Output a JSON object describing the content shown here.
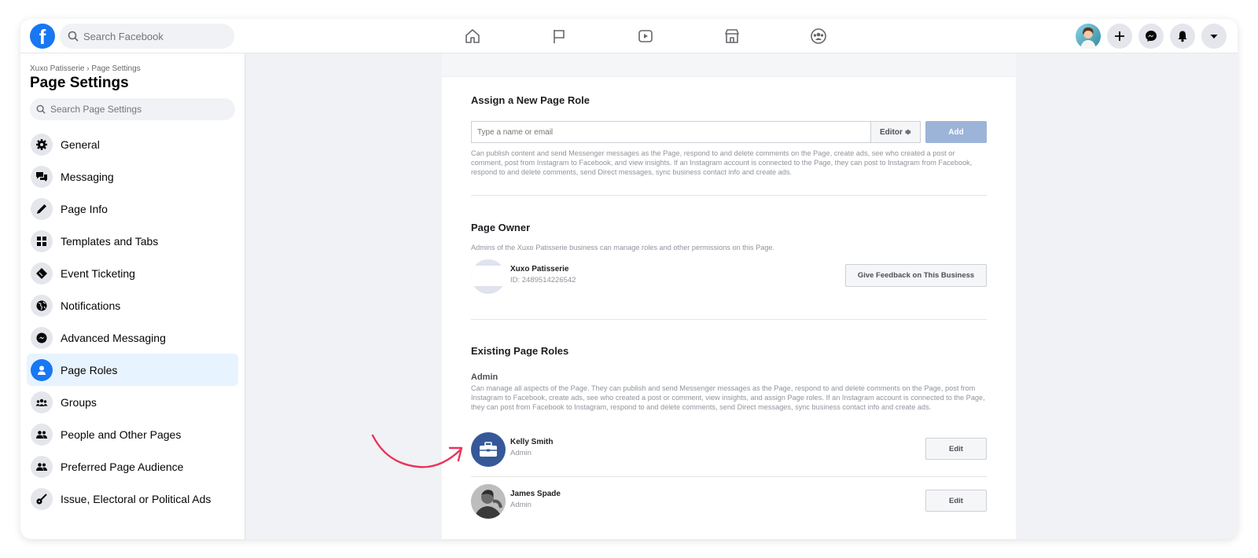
{
  "topbar": {
    "logo_letter": "f",
    "search_placeholder": "Search Facebook",
    "nav_icons": [
      "home-icon",
      "flag-icon",
      "video-icon",
      "marketplace-icon",
      "groups-icon"
    ],
    "right_icons": [
      "avatar",
      "plus-icon",
      "messenger-icon",
      "bell-icon",
      "caret-down-icon"
    ]
  },
  "sidebar": {
    "breadcrumb": "Xuxo Patisserie › Page Settings",
    "title": "Page Settings",
    "search_placeholder": "Search Page Settings",
    "items": [
      {
        "label": "General",
        "icon": "gear-icon"
      },
      {
        "label": "Messaging",
        "icon": "chat-icon"
      },
      {
        "label": "Page Info",
        "icon": "pencil-icon"
      },
      {
        "label": "Templates and Tabs",
        "icon": "grid-icon"
      },
      {
        "label": "Event Ticketing",
        "icon": "ticket-icon"
      },
      {
        "label": "Notifications",
        "icon": "globe-icon"
      },
      {
        "label": "Advanced Messaging",
        "icon": "messenger-icon"
      },
      {
        "label": "Page Roles",
        "icon": "person-icon",
        "active": true
      },
      {
        "label": "Groups",
        "icon": "group-icon"
      },
      {
        "label": "People and Other Pages",
        "icon": "people-icon"
      },
      {
        "label": "Preferred Page Audience",
        "icon": "people-icon"
      },
      {
        "label": "Issue, Electoral or Political Ads",
        "icon": "guitar-icon"
      }
    ]
  },
  "assign": {
    "title": "Assign a New Page Role",
    "input_placeholder": "Type a name or email",
    "role_select": "Editor ≑",
    "add_label": "Add",
    "description": "Can publish content and send Messenger messages as the Page, respond to and delete comments on the Page, create ads, see who created a post or comment, post from Instagram to Facebook, and view insights. If an Instagram account is connected to the Page, they can post to Instagram from Facebook, respond to and delete comments, send Direct messages, sync business contact info and create ads."
  },
  "owner": {
    "title": "Page Owner",
    "description": "Admins of the Xuxo Patisserie business can manage roles and other permissions on this Page.",
    "name": "Xuxo Patisserie",
    "id_text": "ID: 2489514226542",
    "feedback_label": "Give Feedback on This Business"
  },
  "existing": {
    "title": "Existing Page Roles",
    "admin_heading": "Admin",
    "admin_description": "Can manage all aspects of the Page. They can publish and send Messenger messages as the Page, respond to and delete comments on the Page, post from Instagram to Facebook, create ads, see who created a post or comment, view insights, and assign Page roles. If an Instagram account is connected to the Page, they can post from Facebook to Instagram, respond to and delete comments, send Direct messages, sync business contact info and create ads.",
    "people": [
      {
        "name": "Kelly Smith",
        "role": "Admin",
        "edit_label": "Edit"
      },
      {
        "name": "James Spade",
        "role": "Admin",
        "edit_label": "Edit"
      }
    ]
  },
  "colors": {
    "brand": "#1877f2",
    "active_bg": "#e7f3ff",
    "arrow": "#e8345c",
    "add_button": "#9cb4d8"
  }
}
